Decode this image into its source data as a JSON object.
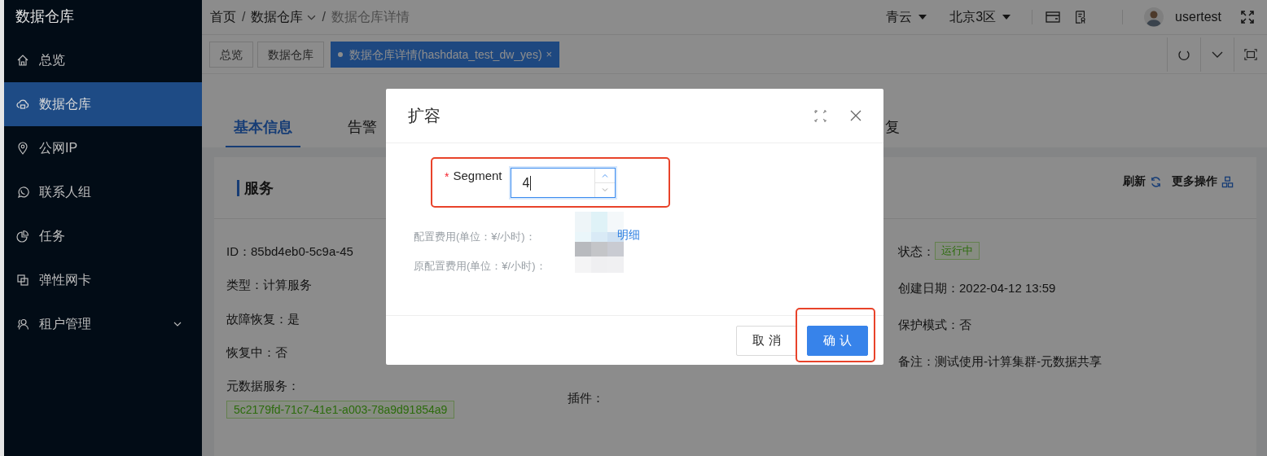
{
  "sidebar": {
    "title": "数据仓库",
    "items": [
      {
        "label": "总览",
        "selected": false,
        "submenu": false
      },
      {
        "label": "数据仓库",
        "selected": true,
        "submenu": false
      },
      {
        "label": "公网IP",
        "selected": false,
        "submenu": false
      },
      {
        "label": "联系人组",
        "selected": false,
        "submenu": false
      },
      {
        "label": "任务",
        "selected": false,
        "submenu": false
      },
      {
        "label": "弹性网卡",
        "selected": false,
        "submenu": false
      },
      {
        "label": "租户管理",
        "selected": false,
        "submenu": true
      }
    ]
  },
  "breadcrumb": [
    {
      "label": "首页",
      "dropdown": false
    },
    {
      "separator": "/",
      "label": "数据仓库",
      "dropdown": true
    },
    {
      "separator": "/",
      "label": "数据仓库详情",
      "dropdown": false
    }
  ],
  "header": {
    "cloud": "青云",
    "region": "北京3区",
    "user": "usertest"
  },
  "page_tabs": [
    {
      "label": "总览",
      "selected": false
    },
    {
      "label": "数据仓库",
      "selected": false
    },
    {
      "label": "数据仓库详情(hashdata_test_dw_yes)",
      "selected": true,
      "close": "×"
    }
  ],
  "detail_tabs": [
    {
      "label": "基本信息",
      "selected": true
    },
    {
      "label": "告警",
      "selected": false
    },
    {
      "label": "复",
      "selected": false
    }
  ],
  "service": {
    "title": "服务",
    "refresh": "刷新",
    "more": "更多操作",
    "columns": [
      [
        {
          "kind": "text",
          "text": "ID：85bd4eb0-5c9a-45"
        },
        {
          "kind": "text",
          "text": "类型：计算服务"
        },
        {
          "kind": "text",
          "text": "故障恢复：是"
        },
        {
          "kind": "text",
          "text": "恢复中：否"
        },
        {
          "kind": "block_tag",
          "label": "元数据服务：",
          "tag": "5c2179fd-71c7-41e1-a003-78a9d91854a9"
        }
      ],
      [
        {
          "kind": "text",
          "text": "插件："
        }
      ],
      [
        {
          "kind": "tag",
          "label": "状态：",
          "tag": "运行中"
        },
        {
          "kind": "text",
          "text": "创建日期：2022-04-12 13:59"
        },
        {
          "kind": "text",
          "text": "保护模式：否"
        },
        {
          "kind": "text",
          "text": "备注：测试使用-计算集群-元数据共享"
        }
      ]
    ]
  },
  "modal": {
    "title": "扩容",
    "field": {
      "required_mark": "*",
      "label": "Segment",
      "value": "4",
      "highlighted": true
    },
    "costs": [
      {
        "label": "配置费用(单位：¥/小时)：",
        "link": "明细"
      },
      {
        "label": "原配置费用(单位：¥/小时)："
      }
    ],
    "buttons": [
      {
        "label": "取 消",
        "kind": "default",
        "highlighted": false
      },
      {
        "label": "确 认",
        "kind": "primary",
        "highlighted": true
      }
    ]
  }
}
